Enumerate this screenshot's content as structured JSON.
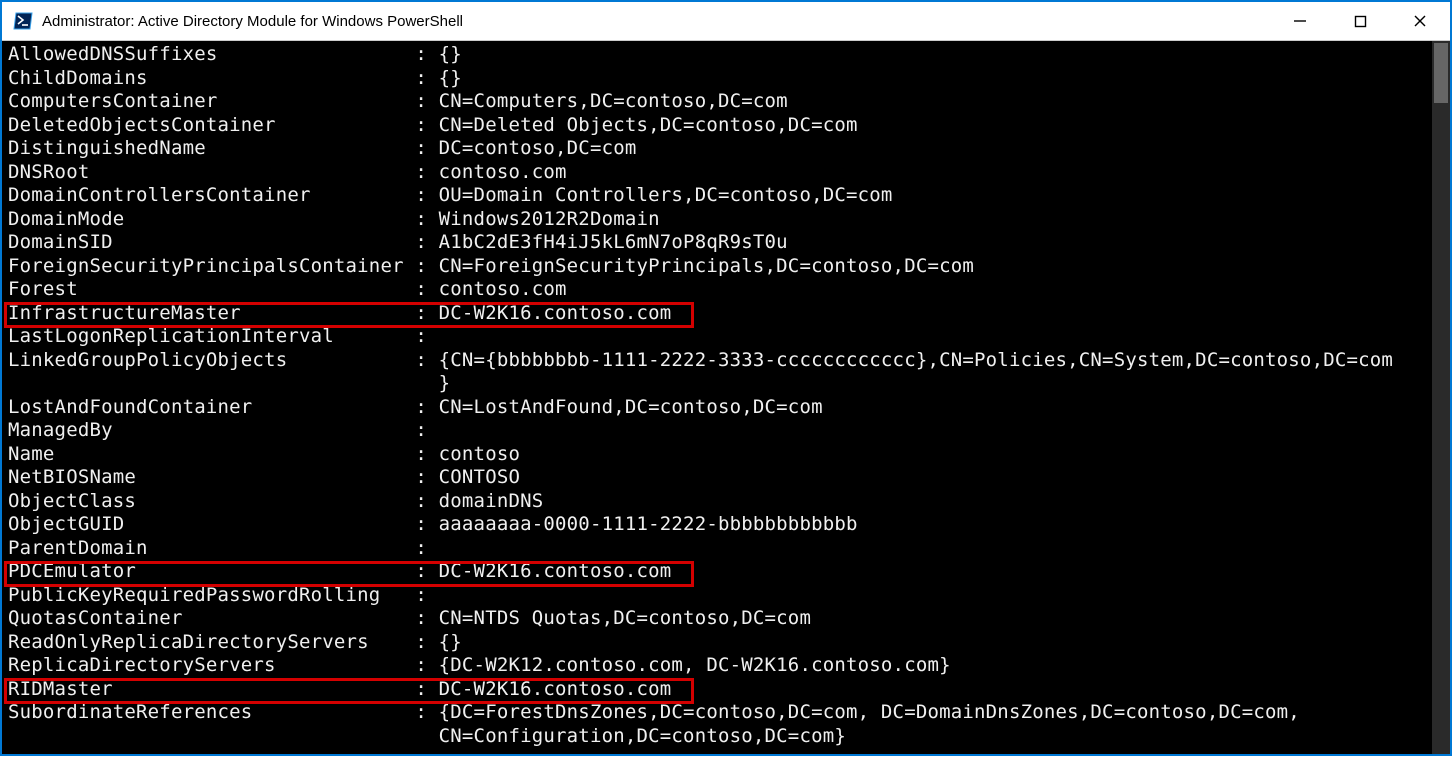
{
  "window": {
    "title": "Administrator: Active Directory Module for Windows PowerShell"
  },
  "lines": {
    "l0": "AllowedDNSSuffixes                 : {}",
    "l1": "ChildDomains                       : {}",
    "l2": "ComputersContainer                 : CN=Computers,DC=contoso,DC=com",
    "l3": "DeletedObjectsContainer            : CN=Deleted Objects,DC=contoso,DC=com",
    "l4": "DistinguishedName                  : DC=contoso,DC=com",
    "l5": "DNSRoot                            : contoso.com",
    "l6": "DomainControllersContainer         : OU=Domain Controllers,DC=contoso,DC=com",
    "l7": "DomainMode                         : Windows2012R2Domain",
    "l8": "DomainSID                          : A1bC2dE3fH4iJ5kL6mN7oP8qR9sT0u",
    "l9": "ForeignSecurityPrincipalsContainer : CN=ForeignSecurityPrincipals,DC=contoso,DC=com",
    "l10": "Forest                             : contoso.com",
    "l11": "InfrastructureMaster               : DC-W2K16.contoso.com",
    "l12": "LastLogonReplicationInterval       :",
    "l13": "LinkedGroupPolicyObjects           : {CN={bbbbbbbb-1111-2222-3333-cccccccccccc},CN=Policies,CN=System,DC=contoso,DC=com",
    "l14": "                                     }",
    "l15": "LostAndFoundContainer              : CN=LostAndFound,DC=contoso,DC=com",
    "l16": "ManagedBy                          :",
    "l17": "Name                               : contoso",
    "l18": "NetBIOSName                        : CONTOSO",
    "l19": "ObjectClass                        : domainDNS",
    "l20": "ObjectGUID                         : aaaaaaaa-0000-1111-2222-bbbbbbbbbbbb",
    "l21": "ParentDomain                       :",
    "l22": "PDCEmulator                        : DC-W2K16.contoso.com",
    "l23": "PublicKeyRequiredPasswordRolling   :",
    "l24": "QuotasContainer                    : CN=NTDS Quotas,DC=contoso,DC=com",
    "l25": "ReadOnlyReplicaDirectoryServers    : {}",
    "l26": "ReplicaDirectoryServers            : {DC-W2K12.contoso.com, DC-W2K16.contoso.com}",
    "l27": "RIDMaster                          : DC-W2K16.contoso.com",
    "l28": "SubordinateReferences              : {DC=ForestDnsZones,DC=contoso,DC=com, DC=DomainDnsZones,DC=contoso,DC=com,",
    "l29": "                                     CN=Configuration,DC=contoso,DC=com}"
  }
}
